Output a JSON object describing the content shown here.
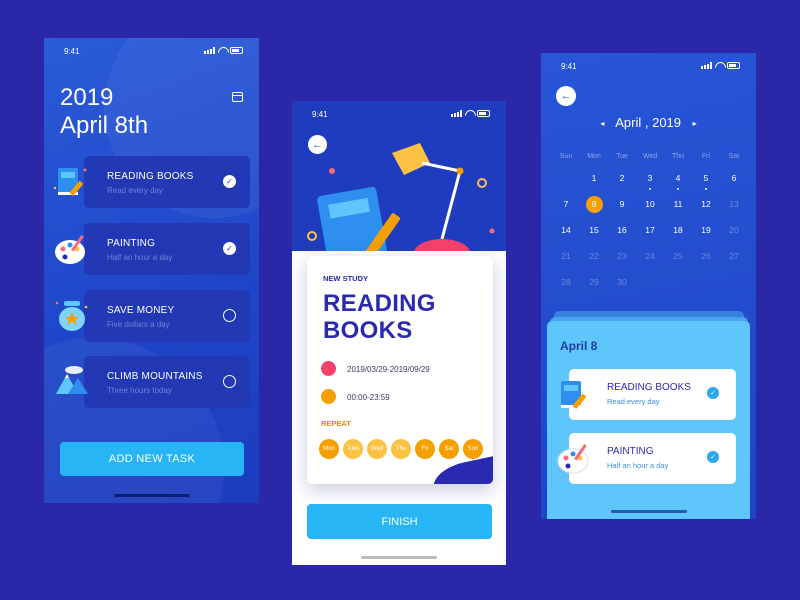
{
  "colors": {
    "background": "#2a27a9",
    "accent": "#28b5f5",
    "orange": "#f5a000",
    "indigo": "#2a2ab0"
  },
  "screen1": {
    "time": "9:41",
    "year": "2019",
    "date": "April 8th",
    "tasks": [
      {
        "title": "READING BOOKS",
        "subtitle": "Read every day",
        "done": true,
        "icon": "book-pencil-icon"
      },
      {
        "title": "PAINTING",
        "subtitle": "Half an hour a day",
        "done": true,
        "icon": "palette-icon"
      },
      {
        "title": "SAVE MONEY",
        "subtitle": "Five dollars a day",
        "done": false,
        "icon": "money-jar-icon"
      },
      {
        "title": "CLIMB MOUNTAINS",
        "subtitle": "Three hours today",
        "done": false,
        "icon": "mountain-icon"
      }
    ],
    "add_label": "ADD NEW TASK",
    "check_glyph": "✓"
  },
  "screen2": {
    "time": "9:41",
    "back_glyph": "←",
    "kicker": "NEW STUDY",
    "title_line1": "READING",
    "title_line2": "BOOKS",
    "date_range": "2019/03/29-2019/09/29",
    "time_range": "00:00-23:59",
    "repeat_label": "REPEAT",
    "days": [
      {
        "label": "Mon",
        "on": true
      },
      {
        "label": "Tues",
        "on": false
      },
      {
        "label": "Wed",
        "on": false
      },
      {
        "label": "Thu",
        "on": false
      },
      {
        "label": "Fri",
        "on": true
      },
      {
        "label": "Sat",
        "on": true
      },
      {
        "label": "Sun",
        "on": true
      }
    ],
    "finish_label": "FINISH"
  },
  "screen3": {
    "time": "9:41",
    "back_glyph": "←",
    "prev_glyph": "◂",
    "next_glyph": "▸",
    "month": "April , 2019",
    "weekdays": [
      "Sun",
      "Mon",
      "Tue",
      "Wed",
      "Thu",
      "Fri",
      "Sat"
    ],
    "weeks": [
      [
        "",
        "1",
        "2",
        "3",
        "4",
        "5",
        "6"
      ],
      [
        "7",
        "8",
        "9",
        "10",
        "11",
        "12",
        "13"
      ],
      [
        "14",
        "15",
        "16",
        "17",
        "18",
        "19",
        "20"
      ],
      [
        "21",
        "22",
        "23",
        "24",
        "25",
        "26",
        "27"
      ],
      [
        "28",
        "29",
        "30",
        "",
        "",
        "",
        ""
      ]
    ],
    "selected_day": "8",
    "dot_days": [
      "3",
      "4",
      "5"
    ],
    "sheet_date": "April 8",
    "tasks": [
      {
        "title": "READING BOOKS",
        "subtitle": "Read every day",
        "icon": "book-pencil-icon"
      },
      {
        "title": "PAINTING",
        "subtitle": "Half an hour a day",
        "icon": "palette-icon"
      }
    ],
    "check_glyph": "✓"
  }
}
